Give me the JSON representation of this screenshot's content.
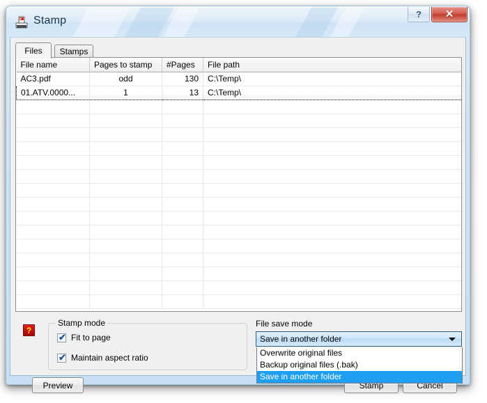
{
  "window": {
    "title": "Stamp",
    "icon": "stamp-icon",
    "help_label": "?",
    "close_label": "✕"
  },
  "tabs": [
    {
      "label": "Files",
      "active": true
    },
    {
      "label": "Stamps",
      "active": false
    }
  ],
  "grid": {
    "columns": [
      "File name",
      "Pages to stamp",
      "#Pages",
      "File path"
    ],
    "rows": [
      {
        "file_name": "AC3.pdf",
        "pages_to_stamp": "odd",
        "num_pages": "130",
        "file_path": "C:\\Temp\\",
        "focused": false
      },
      {
        "file_name": "01.ATV.0000...",
        "pages_to_stamp": "1",
        "num_pages": "13",
        "file_path": "C:\\Temp\\",
        "focused": true
      }
    ],
    "empty_row_count": 12
  },
  "options": {
    "hint_icon_label": "?",
    "stamp_mode": {
      "title": "Stamp mode",
      "checkboxes": [
        {
          "label": "Fit to page",
          "checked": true,
          "mark": "✔"
        },
        {
          "label": "Maintain aspect ratio",
          "checked": true,
          "mark": "✔"
        }
      ]
    },
    "file_save_mode": {
      "label": "File save mode",
      "selected": "Save in another folder",
      "expanded": true,
      "options": [
        {
          "label": "Overwrite original files",
          "selected": false
        },
        {
          "label": "Backup original files (.bak)",
          "selected": false
        },
        {
          "label": "Save in another folder",
          "selected": true
        }
      ]
    }
  },
  "footer": {
    "preview_label": "Preview",
    "stamp_label": "Stamp",
    "cancel_label": "Cancel"
  },
  "colors": {
    "glass": "#cfe3f5",
    "close_red": "#c13b2c",
    "highlight_blue": "#1e9ff2",
    "check_blue": "#2356a0",
    "hint_red": "#c00000",
    "hint_yellow": "#ffe600"
  }
}
